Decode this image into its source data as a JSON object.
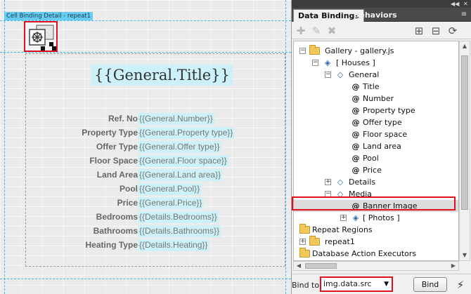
{
  "canvas": {
    "cell_tag": "Cell Binding Detail - repeat1",
    "general_title": "{{General.Title}}",
    "fields": [
      {
        "label": "Ref. No",
        "value": "{{General.Number}}"
      },
      {
        "label": "Property Type",
        "value": "{{General.Property type}}"
      },
      {
        "label": "Offer Type",
        "value": "{{General.Offer type}}"
      },
      {
        "label": "Floor Space",
        "value": "{{General.Floor space}}"
      },
      {
        "label": "Land Area",
        "value": "{{General.Land area}}"
      },
      {
        "label": "Pool",
        "value": "{{General.Pool}}"
      },
      {
        "label": "Price",
        "value": "{{General.Price}}"
      },
      {
        "label": "Bedrooms",
        "value": "{{Details.Bedrooms}}"
      },
      {
        "label": "Bathrooms",
        "value": "{{Details.Bathrooms}}"
      },
      {
        "label": "Heating Type",
        "value": "{{Details.Heating}}"
      }
    ]
  },
  "panel": {
    "tabs": [
      {
        "label": "Data Bindings",
        "active": true
      },
      {
        "label": "Behaviors",
        "active": false
      }
    ],
    "toolbar_icons": [
      "plus-icon",
      "pencil-icon",
      "x-icon",
      "add-box-icon",
      "remove-box-icon",
      "refresh-icon"
    ],
    "tree": [
      {
        "label": "Gallery - gallery.js",
        "icon": "folder-icon",
        "expander": "-"
      },
      {
        "label": "[ Houses ]",
        "icon": "array-object-icon",
        "expander": "-"
      },
      {
        "label": "General",
        "icon": "object-icon",
        "expander": "-"
      },
      {
        "label": "Title",
        "icon": "at-icon"
      },
      {
        "label": "Number",
        "icon": "at-icon"
      },
      {
        "label": "Property type",
        "icon": "at-icon"
      },
      {
        "label": "Offer type",
        "icon": "at-icon"
      },
      {
        "label": "Floor space",
        "icon": "at-icon"
      },
      {
        "label": "Land area",
        "icon": "at-icon"
      },
      {
        "label": "Pool",
        "icon": "at-icon"
      },
      {
        "label": "Price",
        "icon": "at-icon"
      },
      {
        "label": "Details",
        "icon": "object-icon",
        "expander": "+"
      },
      {
        "label": "Media",
        "icon": "object-icon",
        "expander": "-"
      },
      {
        "label": "Banner Image",
        "icon": "at-icon",
        "selected": true
      },
      {
        "label": "[ Photos ]",
        "icon": "array-object-icon",
        "expander": "+"
      },
      {
        "label": "Repeat Regions",
        "icon": "folder-icon",
        "expander": "-"
      },
      {
        "label": "repeat1",
        "icon": "folder-icon",
        "expander": "+"
      },
      {
        "label": "Database Action Executors",
        "icon": "folder-icon"
      }
    ],
    "bind_to_label": "Bind to:",
    "bind_to_value": "img.data.src",
    "bind_button": "Bind"
  }
}
